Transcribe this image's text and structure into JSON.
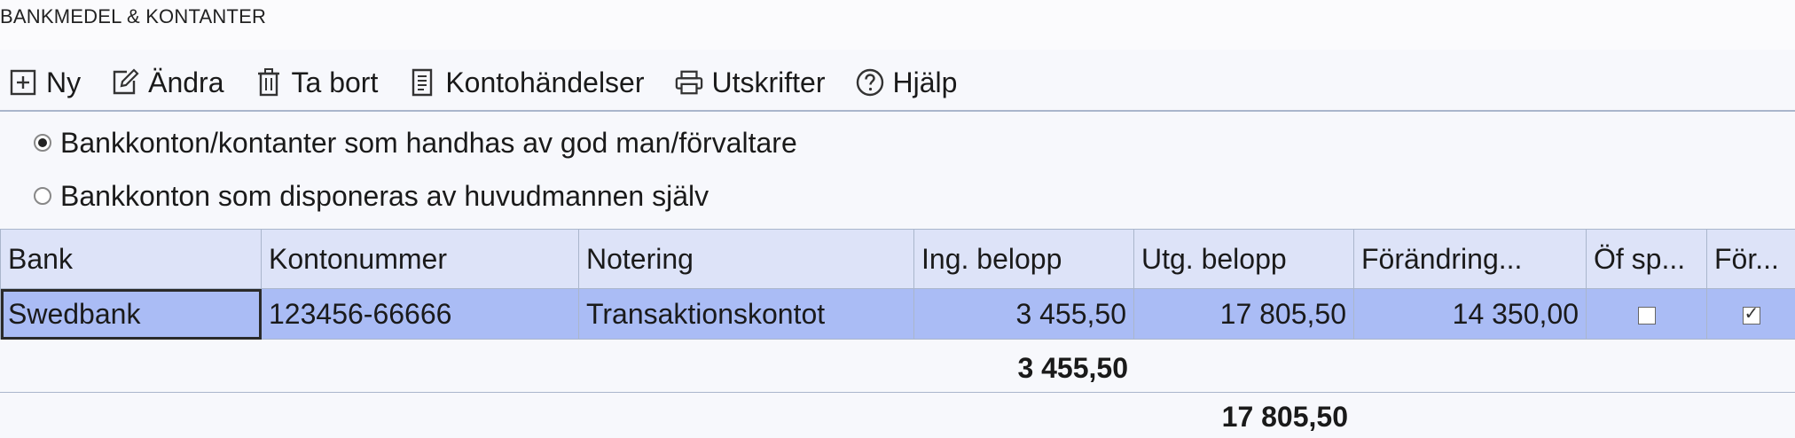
{
  "window": {
    "title": "BANKMEDEL & KONTANTER"
  },
  "toolbar": {
    "items": [
      {
        "label": "Ny",
        "icon": "plus-square-icon"
      },
      {
        "label": "Ändra",
        "icon": "edit-icon"
      },
      {
        "label": "Ta bort",
        "icon": "trash-icon"
      },
      {
        "label": "Kontohändelser",
        "icon": "ledger-icon"
      },
      {
        "label": "Utskrifter",
        "icon": "printer-icon"
      },
      {
        "label": "Hjälp",
        "icon": "help-icon"
      }
    ]
  },
  "radio": {
    "option1": "Bankkonton/kontanter som handhas av god man/förvaltare",
    "option2": "Bankkonton som disponeras av huvudmannen själv",
    "selected": 1
  },
  "table": {
    "headers": [
      "Bank",
      "Kontonummer",
      "Notering",
      "Ing. belopp",
      "Utg. belopp",
      "Förändring...",
      "Öf sp...",
      "För..."
    ],
    "rows": [
      {
        "bank": "Swedbank",
        "kontonummer": "123456-66666",
        "notering": "Transaktionskontot",
        "ing_belopp": "3 455,50",
        "utg_belopp": "17 805,50",
        "forandring": "14 350,00",
        "of_sp": false,
        "for": true
      }
    ]
  },
  "totals": {
    "ing_belopp": "3 455,50",
    "utg_belopp": "17 805,50"
  },
  "colors": {
    "header_bg": "#dde3f8",
    "row_selected": "#aabcf5",
    "border": "#aab6cc"
  }
}
